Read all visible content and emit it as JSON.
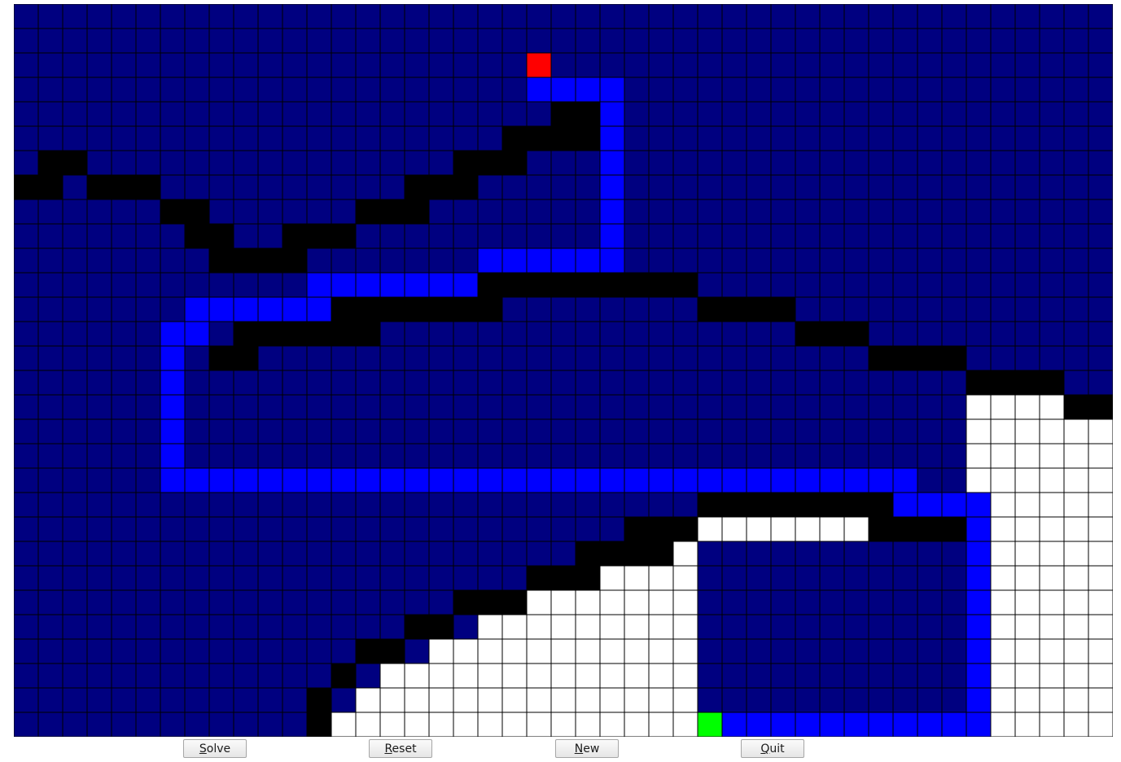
{
  "colors": {
    "open": "#000080",
    "wall": "#000000",
    "path": "#0000ff",
    "visited": "#ffffff",
    "start": "#ff0000",
    "goal": "#00ff00",
    "gridline": "#000000"
  },
  "legend": {
    "0": "open",
    "1": "wall",
    "2": "path",
    "3": "visited",
    "S": "start",
    "G": "goal"
  },
  "maze": {
    "rows": 30,
    "cols": 45,
    "cells": [
      "000000000000000000000000000000000000000000000",
      "000000000000000000000000000000000000000000000",
      "000000000000000000000S00000000000000000000000",
      "000000000000000000000222200000000000000000000",
      "000000000000000000000011200000000000000000000",
      "000000000000000000001111200000000000000000000",
      "011000000000000000111000200000000000000000000",
      "110111000000000011100000200000000000000000000",
      "000000110000001110000000200000000000000000000",
      "000000011001110000000000200000000000000000000",
      "000000001111000000022222200000000000000000000",
      "000000000000222222211111111100000000000000000",
      "000000022222211111110000000011110000000000000",
      "000000220111111000000000000000001110000000000",
      "000000201100000000000000000000000001111000000",
      "000000200000000000000000000000000000000111100",
      "000000200000000000000000000000000000000333311",
      "000000200000000000000000000000000000000333333",
      "000000200000000000000000000000000000000333333",
      "000000222222222222222222222222222222200333333",
      "000000000000000000000000000011111111222233333",
      "000000000000000000000000011133333331111233333",
      "000000000000000000000001111300000000000233333",
      "000000000000000000000111333300000000000233333",
      "000000000000000000111333333300000000000233333",
      "000000000000000011033333333300000000000233333",
      "000000000000001103333333333300000000000233333",
      "000000000000010333333333333300000000000233333",
      "000000000000103333333333333300000000000233333",
      "0000000000001333333333333333G2222222222233333"
    ]
  },
  "buttons": {
    "solve": {
      "mnemonic": "S",
      "rest": "olve"
    },
    "reset": {
      "mnemonic": "R",
      "rest": "eset"
    },
    "new": {
      "mnemonic": "N",
      "rest": "ew"
    },
    "quit": {
      "mnemonic": "Q",
      "rest": "uit"
    }
  }
}
